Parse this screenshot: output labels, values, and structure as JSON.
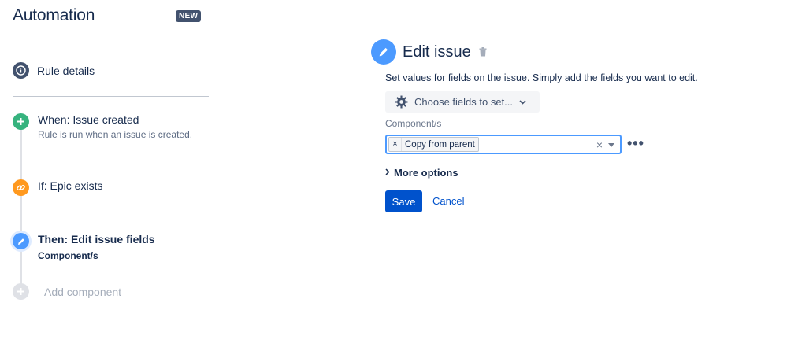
{
  "app": {
    "title": "Automation",
    "badge": "NEW"
  },
  "sidebar": {
    "rule_details_label": "Rule details",
    "steps": [
      {
        "title": "When: Issue created",
        "subtitle": "Rule is run when an issue is created.",
        "icon": "plus-icon",
        "color": "#36b37e"
      },
      {
        "title": "If: Epic exists",
        "subtitle": "",
        "icon": "link-icon",
        "color": "#ff991f"
      },
      {
        "title": "Then: Edit issue fields",
        "subtitle": "Component/s",
        "icon": "pencil-icon",
        "color": "#4c9aff"
      }
    ],
    "add_component_label": "Add component"
  },
  "editor": {
    "title": "Edit issue",
    "description": "Set values for fields on the issue. Simply add the fields you want to edit.",
    "choose_fields_label": "Choose fields to set...",
    "field_label": "Component/s",
    "selected_tags": [
      "Copy from parent"
    ],
    "tag_remove_glyph": "×",
    "clear_glyph": "×",
    "more_glyph": "•••",
    "more_options_label": "More options",
    "save_label": "Save",
    "cancel_label": "Cancel"
  },
  "colors": {
    "primary": "#0052cc",
    "accent_blue": "#4c9aff",
    "text_dark": "#172b4d",
    "badge_bg": "#42526e"
  }
}
